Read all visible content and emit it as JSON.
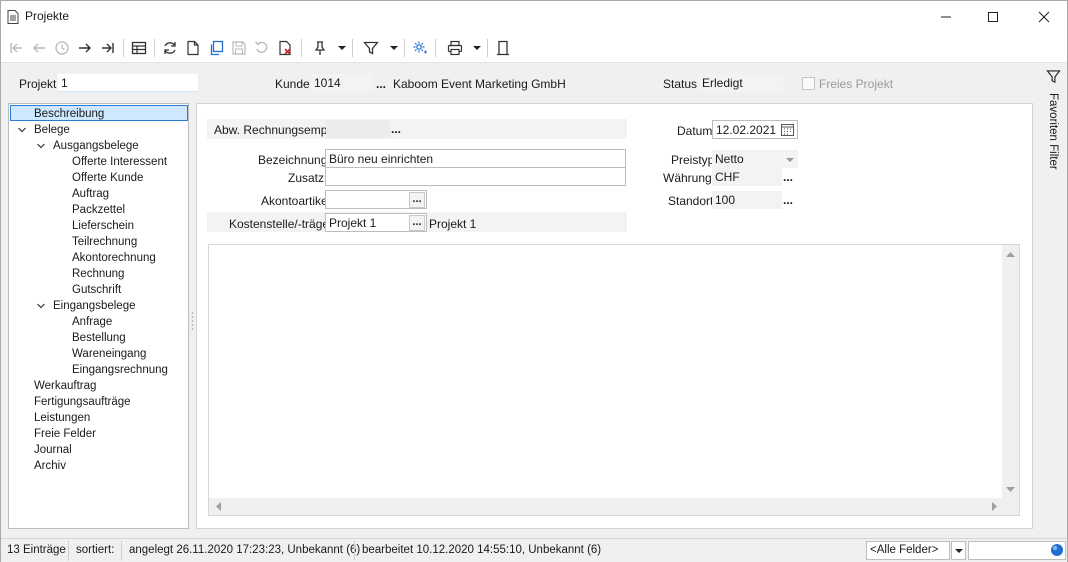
{
  "window": {
    "title": "Projekte",
    "controls": [
      "minimize",
      "maximize",
      "close"
    ]
  },
  "toolbar": {
    "icons": [
      "first-icon",
      "back-icon",
      "history-icon",
      "forward-icon",
      "last-icon",
      "table-icon",
      "refresh-icon",
      "new-doc-icon",
      "copy-icon",
      "save-icon",
      "undo-icon",
      "delete-icon",
      "pin-icon",
      "filter-icon",
      "settings-icon",
      "print-icon",
      "door-icon"
    ]
  },
  "header": {
    "projekt_label": "Projekt",
    "projekt_value": "1",
    "kunde_label": "Kunde",
    "kunde_number": "1014",
    "kunde_ellipsis": "...",
    "kunde_name": "Kaboom Event Marketing GmbH",
    "status_label": "Status",
    "status_value": "Erledigt",
    "freies_projekt_label": "Freies Projekt"
  },
  "tree": {
    "items": [
      {
        "label": "Beschreibung",
        "level": 1,
        "selected": true
      },
      {
        "label": "Belege",
        "level": 1,
        "expanded": true
      },
      {
        "label": "Ausgangsbelege",
        "level": 2,
        "expanded": true
      },
      {
        "label": "Offerte Interessent",
        "level": 3
      },
      {
        "label": "Offerte Kunde",
        "level": 3
      },
      {
        "label": "Auftrag",
        "level": 3
      },
      {
        "label": "Packzettel",
        "level": 3
      },
      {
        "label": "Lieferschein",
        "level": 3
      },
      {
        "label": "Teilrechnung",
        "level": 3
      },
      {
        "label": "Akontorechnung",
        "level": 3
      },
      {
        "label": "Rechnung",
        "level": 3
      },
      {
        "label": "Gutschrift",
        "level": 3
      },
      {
        "label": "Eingangsbelege",
        "level": 2,
        "expanded": true
      },
      {
        "label": "Anfrage",
        "level": 3
      },
      {
        "label": "Bestellung",
        "level": 3
      },
      {
        "label": "Wareneingang",
        "level": 3
      },
      {
        "label": "Eingangsrechnung",
        "level": 3
      },
      {
        "label": "Werkauftrag",
        "level": 1
      },
      {
        "label": "Fertigungsaufträge",
        "level": 1
      },
      {
        "label": "Leistungen",
        "level": 1
      },
      {
        "label": "Freie Felder",
        "level": 1
      },
      {
        "label": "Journal",
        "level": 1
      },
      {
        "label": "Archiv",
        "level": 1
      }
    ]
  },
  "form": {
    "abw_label": "Abw. Rechnungsempf.",
    "abw_value": "",
    "bezeichnung_label": "Bezeichnung",
    "bezeichnung_value": "Büro neu einrichten",
    "zusatz_label": "Zusatz",
    "zusatz_value": "",
    "akontoartikel_label": "Akontoartikel",
    "akontoartikel_value": "",
    "kostenstelle_label": "Kostenstelle/-träger",
    "kostenstelle_value": "Projekt 1",
    "kostenstelle_name": "Projekt 1",
    "datum_label": "Datum",
    "datum_value": "12.02.2021",
    "preistyp_label": "Preistyp",
    "preistyp_value": "Netto",
    "waehrung_label": "Währung",
    "waehrung_value": "CHF",
    "standort_label": "Standort",
    "standort_value": "100",
    "ellipsis": "..."
  },
  "right_rail": {
    "label": "Favoriten Filter"
  },
  "statusbar": {
    "count": "13 Einträge",
    "sorted": "sortiert:",
    "created": "angelegt 26.11.2020 17:23:23, Unbekannt (6)",
    "edited": "bearbeitet 10.12.2020 14:55:10, Unbekannt (6)",
    "field_select": "<Alle Felder>",
    "search_value": ""
  },
  "colors": {
    "selection_bg": "#cde8ff",
    "selection_border": "#2b7cd3",
    "accent_blue": "#1e6fd0"
  }
}
